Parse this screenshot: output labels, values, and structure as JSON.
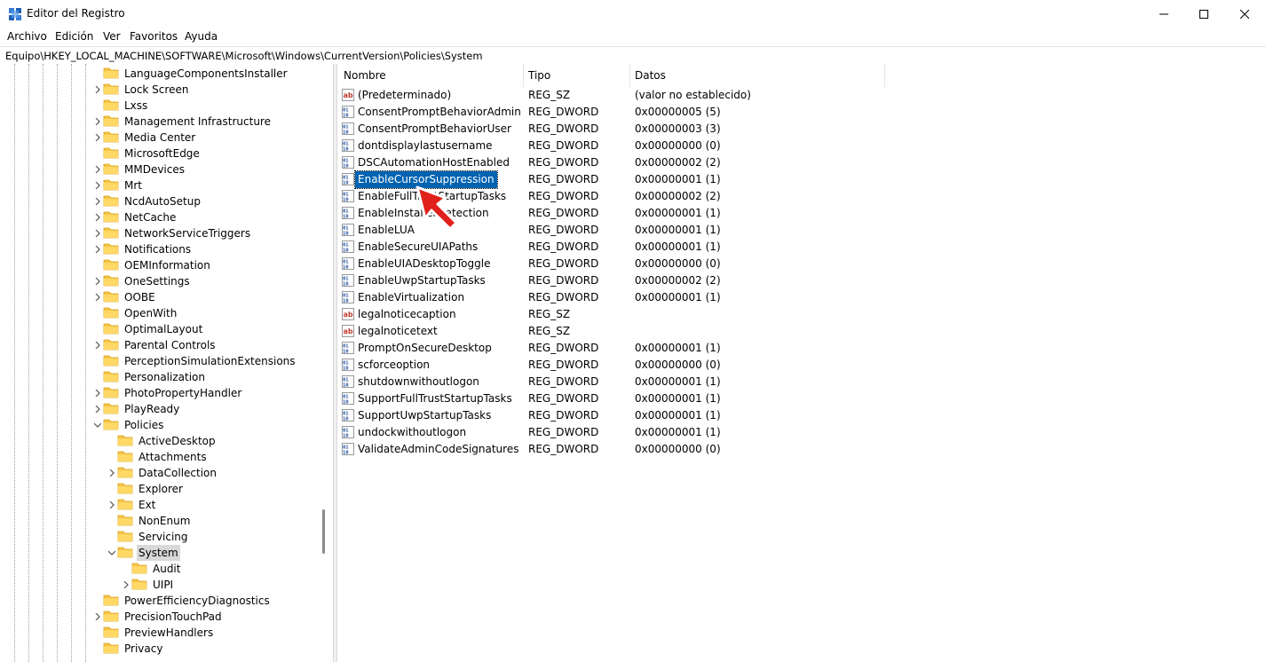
{
  "window": {
    "title": "Editor del Registro",
    "minimize_icon": "minimize-icon",
    "maximize_icon": "maximize-icon",
    "close_icon": "close-icon"
  },
  "menu": [
    {
      "label": "Archivo"
    },
    {
      "label": "Edición"
    },
    {
      "label": "Ver"
    },
    {
      "label": "Favoritos"
    },
    {
      "label": "Ayuda"
    }
  ],
  "address": "Equipo\\HKEY_LOCAL_MACHINE\\SOFTWARE\\Microsoft\\Windows\\CurrentVersion\\Policies\\System",
  "tree": {
    "items": [
      {
        "label": "LanguageComponentsInstaller",
        "expander": "none"
      },
      {
        "label": "Lock Screen",
        "expander": "collapsed"
      },
      {
        "label": "Lxss",
        "expander": "none"
      },
      {
        "label": "Management Infrastructure",
        "expander": "collapsed"
      },
      {
        "label": "Media Center",
        "expander": "collapsed"
      },
      {
        "label": "MicrosoftEdge",
        "expander": "none"
      },
      {
        "label": "MMDevices",
        "expander": "collapsed"
      },
      {
        "label": "Mrt",
        "expander": "collapsed"
      },
      {
        "label": "NcdAutoSetup",
        "expander": "collapsed"
      },
      {
        "label": "NetCache",
        "expander": "collapsed"
      },
      {
        "label": "NetworkServiceTriggers",
        "expander": "collapsed"
      },
      {
        "label": "Notifications",
        "expander": "collapsed"
      },
      {
        "label": "OEMInformation",
        "expander": "none"
      },
      {
        "label": "OneSettings",
        "expander": "collapsed"
      },
      {
        "label": "OOBE",
        "expander": "collapsed"
      },
      {
        "label": "OpenWith",
        "expander": "none"
      },
      {
        "label": "OptimalLayout",
        "expander": "none"
      },
      {
        "label": "Parental Controls",
        "expander": "collapsed"
      },
      {
        "label": "PerceptionSimulationExtensions",
        "expander": "none"
      },
      {
        "label": "Personalization",
        "expander": "none"
      },
      {
        "label": "PhotoPropertyHandler",
        "expander": "collapsed"
      },
      {
        "label": "PlayReady",
        "expander": "collapsed"
      },
      {
        "label": "Policies",
        "expander": "expanded"
      },
      {
        "label": "ActiveDesktop",
        "expander": "none"
      },
      {
        "label": "Attachments",
        "expander": "none"
      },
      {
        "label": "DataCollection",
        "expander": "collapsed"
      },
      {
        "label": "Explorer",
        "expander": "none"
      },
      {
        "label": "Ext",
        "expander": "collapsed"
      },
      {
        "label": "NonEnum",
        "expander": "none"
      },
      {
        "label": "Servicing",
        "expander": "none"
      },
      {
        "label": "System",
        "expander": "expanded"
      },
      {
        "label": "Audit",
        "expander": "none"
      },
      {
        "label": "UIPI",
        "expander": "collapsed"
      },
      {
        "label": "PowerEfficiencyDiagnostics",
        "expander": "none"
      },
      {
        "label": "PrecisionTouchPad",
        "expander": "collapsed"
      },
      {
        "label": "PreviewHandlers",
        "expander": "none"
      },
      {
        "label": "Privacy",
        "expander": "none"
      }
    ],
    "selected": "System"
  },
  "columns": {
    "name": "Nombre",
    "type": "Tipo",
    "data": "Datos"
  },
  "values": [
    {
      "name": "(Predeterminado)",
      "type": "REG_SZ",
      "data": "(valor no establecido)",
      "icon": "string-value-icon"
    },
    {
      "name": "ConsentPromptBehaviorAdmin",
      "type": "REG_DWORD",
      "data": "0x00000005 (5)",
      "icon": "binary-value-icon"
    },
    {
      "name": "ConsentPromptBehaviorUser",
      "type": "REG_DWORD",
      "data": "0x00000003 (3)",
      "icon": "binary-value-icon"
    },
    {
      "name": "dontdisplaylastusername",
      "type": "REG_DWORD",
      "data": "0x00000000 (0)",
      "icon": "binary-value-icon"
    },
    {
      "name": "DSCAutomationHostEnabled",
      "type": "REG_DWORD",
      "data": "0x00000002 (2)",
      "icon": "binary-value-icon"
    },
    {
      "name": "EnableCursorSuppression",
      "type": "REG_DWORD",
      "data": "0x00000001 (1)",
      "icon": "binary-value-icon"
    },
    {
      "name": "EnableFullTrustStartupTasks",
      "type": "REG_DWORD",
      "data": "0x00000002 (2)",
      "icon": "binary-value-icon"
    },
    {
      "name": "EnableInstallerDetection",
      "type": "REG_DWORD",
      "data": "0x00000001 (1)",
      "icon": "binary-value-icon"
    },
    {
      "name": "EnableLUA",
      "type": "REG_DWORD",
      "data": "0x00000001 (1)",
      "icon": "binary-value-icon"
    },
    {
      "name": "EnableSecureUIAPaths",
      "type": "REG_DWORD",
      "data": "0x00000001 (1)",
      "icon": "binary-value-icon"
    },
    {
      "name": "EnableUIADesktopToggle",
      "type": "REG_DWORD",
      "data": "0x00000000 (0)",
      "icon": "binary-value-icon"
    },
    {
      "name": "EnableUwpStartupTasks",
      "type": "REG_DWORD",
      "data": "0x00000002 (2)",
      "icon": "binary-value-icon"
    },
    {
      "name": "EnableVirtualization",
      "type": "REG_DWORD",
      "data": "0x00000001 (1)",
      "icon": "binary-value-icon"
    },
    {
      "name": "legalnoticecaption",
      "type": "REG_SZ",
      "data": "",
      "icon": "string-value-icon"
    },
    {
      "name": "legalnoticetext",
      "type": "REG_SZ",
      "data": "",
      "icon": "string-value-icon"
    },
    {
      "name": "PromptOnSecureDesktop",
      "type": "REG_DWORD",
      "data": "0x00000001 (1)",
      "icon": "binary-value-icon"
    },
    {
      "name": "scforceoption",
      "type": "REG_DWORD",
      "data": "0x00000000 (0)",
      "icon": "binary-value-icon"
    },
    {
      "name": "shutdownwithoutlogon",
      "type": "REG_DWORD",
      "data": "0x00000001 (1)",
      "icon": "binary-value-icon"
    },
    {
      "name": "SupportFullTrustStartupTasks",
      "type": "REG_DWORD",
      "data": "0x00000001 (1)",
      "icon": "binary-value-icon"
    },
    {
      "name": "SupportUwpStartupTasks",
      "type": "REG_DWORD",
      "data": "0x00000001 (1)",
      "icon": "binary-value-icon"
    },
    {
      "name": "undockwithoutlogon",
      "type": "REG_DWORD",
      "data": "0x00000001 (1)",
      "icon": "binary-value-icon"
    },
    {
      "name": "ValidateAdminCodeSignatures",
      "type": "REG_DWORD",
      "data": "0x00000000 (0)",
      "icon": "binary-value-icon"
    }
  ],
  "selected_value": "EnableCursorSuppression",
  "colors": {
    "selection": "#0063b1",
    "tree_selection": "#d9d9d9",
    "folder": "#f6c445",
    "pointer": "#e0201a"
  }
}
